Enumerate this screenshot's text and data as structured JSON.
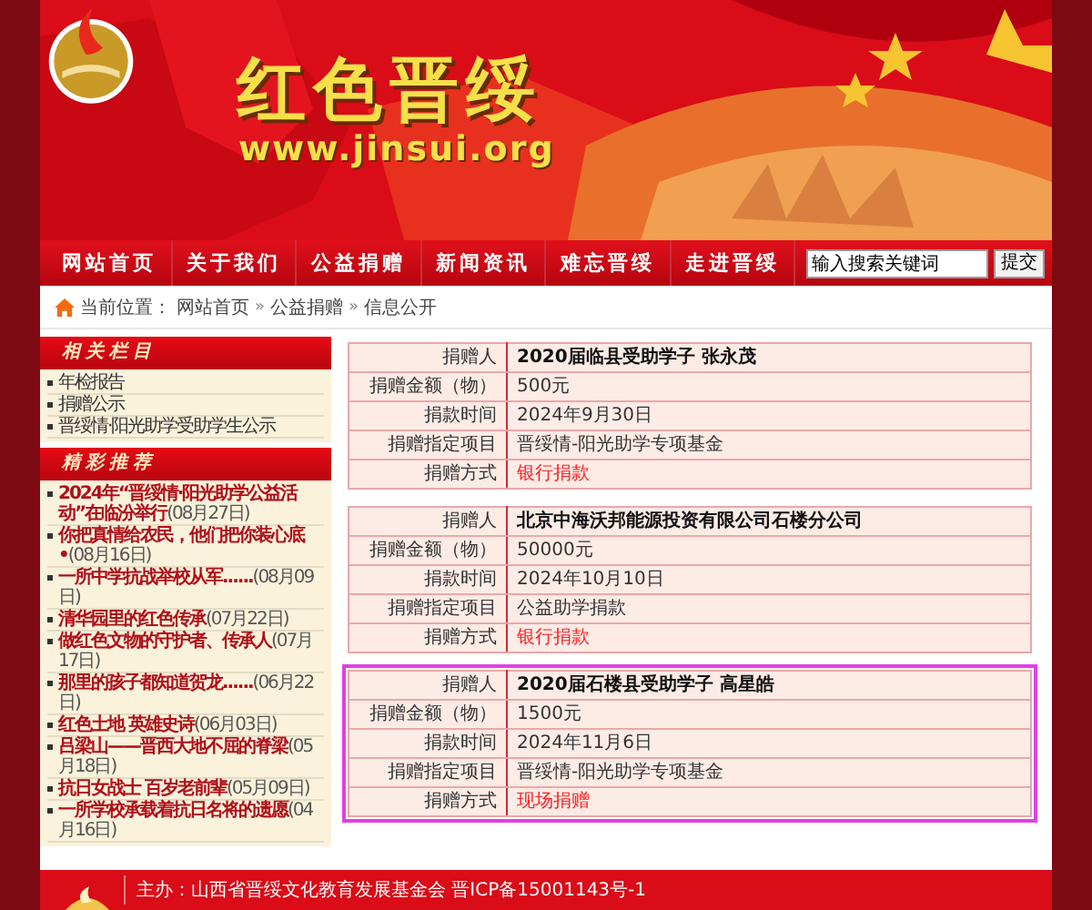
{
  "banner": {
    "title": "红色晋绥",
    "url": "www.jinsui.org"
  },
  "nav": {
    "items": [
      "网站首页",
      "关于我们",
      "公益捐赠",
      "新闻资讯",
      "难忘晋绥",
      "走进晋绥"
    ],
    "search": {
      "value": "输入搜索关键词",
      "button": "提交"
    }
  },
  "breadcrumb": {
    "label": "当前位置：",
    "trail": [
      {
        "kind": "link",
        "text": "网站首页"
      },
      {
        "kind": "sep",
        "text": "»"
      },
      {
        "kind": "link",
        "text": "公益捐赠"
      },
      {
        "kind": "sep",
        "text": "»"
      },
      {
        "kind": "link",
        "text": "信息公开"
      }
    ]
  },
  "sidebar": {
    "sections": [
      {
        "title": "相关栏目",
        "kind": "plain",
        "items": [
          {
            "text": "年检报告"
          },
          {
            "text": "捐赠公示"
          },
          {
            "text": "晋绥情·阳光助学受助学生公示"
          }
        ]
      },
      {
        "title": "精彩推荐",
        "kind": "news",
        "items": [
          {
            "text": "2024年“晋绥情·阳光助学公益活动”在临汾举行",
            "date": "(08月27日)"
          },
          {
            "text": "你把真情给农民，他们把你装心底•",
            "date": "(08月16日)"
          },
          {
            "text": "一所中学抗战举校从军......",
            "date": "(08月09日)"
          },
          {
            "text": "清华园里的红色传承",
            "date": "(07月22日)"
          },
          {
            "text": "做红色文物的守护者、传承人",
            "date": "(07月17日)"
          },
          {
            "text": "那里的孩子都知道贺龙......",
            "date": "(06月22日)"
          },
          {
            "text": "红色土地 英雄史诗",
            "date": "(06月03日)"
          },
          {
            "text": "吕梁山——晋西大地不屈的脊梁",
            "date": "(05月18日)"
          },
          {
            "text": "抗日女战士 百岁老前辈",
            "date": "(05月09日)"
          },
          {
            "text": "一所学校承载着抗日名将的遗愿",
            "date": "(04月16日)"
          }
        ]
      }
    ]
  },
  "records": [
    {
      "highlighted": false,
      "rows": [
        {
          "kind": "name",
          "label": "捐赠人",
          "value": "2020届临县受助学子 张永茂"
        },
        {
          "kind": "plain",
          "label": "捐赠金额（物）",
          "value": "500元"
        },
        {
          "kind": "plain",
          "label": "捐款时间",
          "value": "2024年9月30日"
        },
        {
          "kind": "plain",
          "label": "捐赠指定项目",
          "value": "晋绥情-阳光助学专项基金"
        },
        {
          "kind": "method",
          "label": "捐赠方式",
          "value": "银行捐款"
        }
      ]
    },
    {
      "highlighted": false,
      "rows": [
        {
          "kind": "name",
          "label": "捐赠人",
          "value": "北京中海沃邦能源投资有限公司石楼分公司"
        },
        {
          "kind": "plain",
          "label": "捐赠金额（物）",
          "value": "50000元"
        },
        {
          "kind": "plain",
          "label": "捐款时间",
          "value": "2024年10月10日"
        },
        {
          "kind": "plain",
          "label": "捐赠指定项目",
          "value": "公益助学捐款"
        },
        {
          "kind": "method",
          "label": "捐赠方式",
          "value": "银行捐款"
        }
      ]
    },
    {
      "highlighted": true,
      "rows": [
        {
          "kind": "name",
          "label": "捐赠人",
          "value": "2020届石楼县受助学子 高星皓"
        },
        {
          "kind": "plain",
          "label": "捐赠金额（物）",
          "value": "1500元"
        },
        {
          "kind": "plain",
          "label": "捐款时间",
          "value": "2024年11月6日"
        },
        {
          "kind": "plain",
          "label": "捐赠指定项目",
          "value": "晋绥情-阳光助学专项基金"
        },
        {
          "kind": "method",
          "label": "捐赠方式",
          "value": "现场捐赠"
        }
      ]
    }
  ],
  "footer": {
    "text": "主办：山西省晋绥文化教育发展基金会 晋ICP备15001143号-1"
  }
}
